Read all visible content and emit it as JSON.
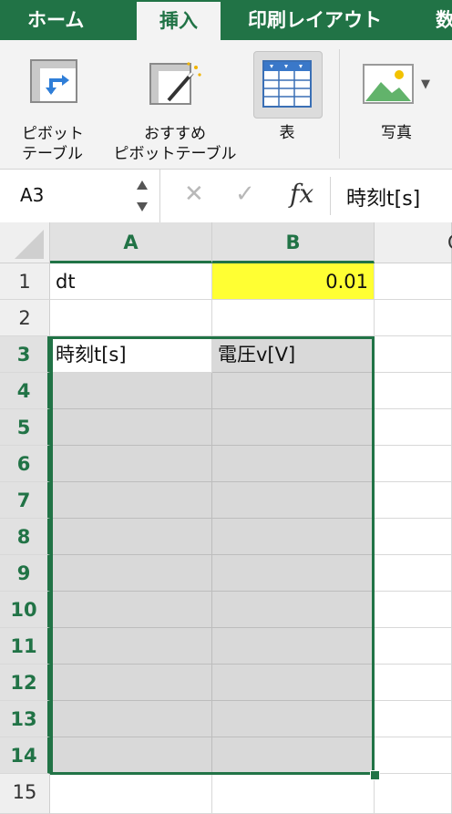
{
  "tabs": [
    {
      "label": "ホーム",
      "active": false
    },
    {
      "label": "挿入",
      "active": true
    },
    {
      "label": "印刷レイアウト",
      "active": false
    },
    {
      "label": "数",
      "active": false
    }
  ],
  "ribbon": {
    "pivot_table": [
      "ピボット",
      "テーブル"
    ],
    "recommended_pivot": [
      "おすすめ",
      "ピボットテーブル"
    ],
    "table": "表",
    "picture": "写真"
  },
  "formula_bar": {
    "name_box": "A3",
    "fx_label": "fx",
    "content": "時刻t[s]"
  },
  "grid": {
    "columns": [
      "A",
      "B",
      "C"
    ],
    "rows": [
      "1",
      "2",
      "3",
      "4",
      "5",
      "6",
      "7",
      "8",
      "9",
      "10",
      "11",
      "12",
      "13",
      "14",
      "15"
    ],
    "cells": {
      "A1": "dt",
      "B1": "0.01",
      "A3": "時刻t[s]",
      "B3": "電圧v[V]"
    }
  },
  "colors": {
    "accent": "#217346",
    "highlight": "#ffff33",
    "range_fill": "#d9d9d9"
  }
}
